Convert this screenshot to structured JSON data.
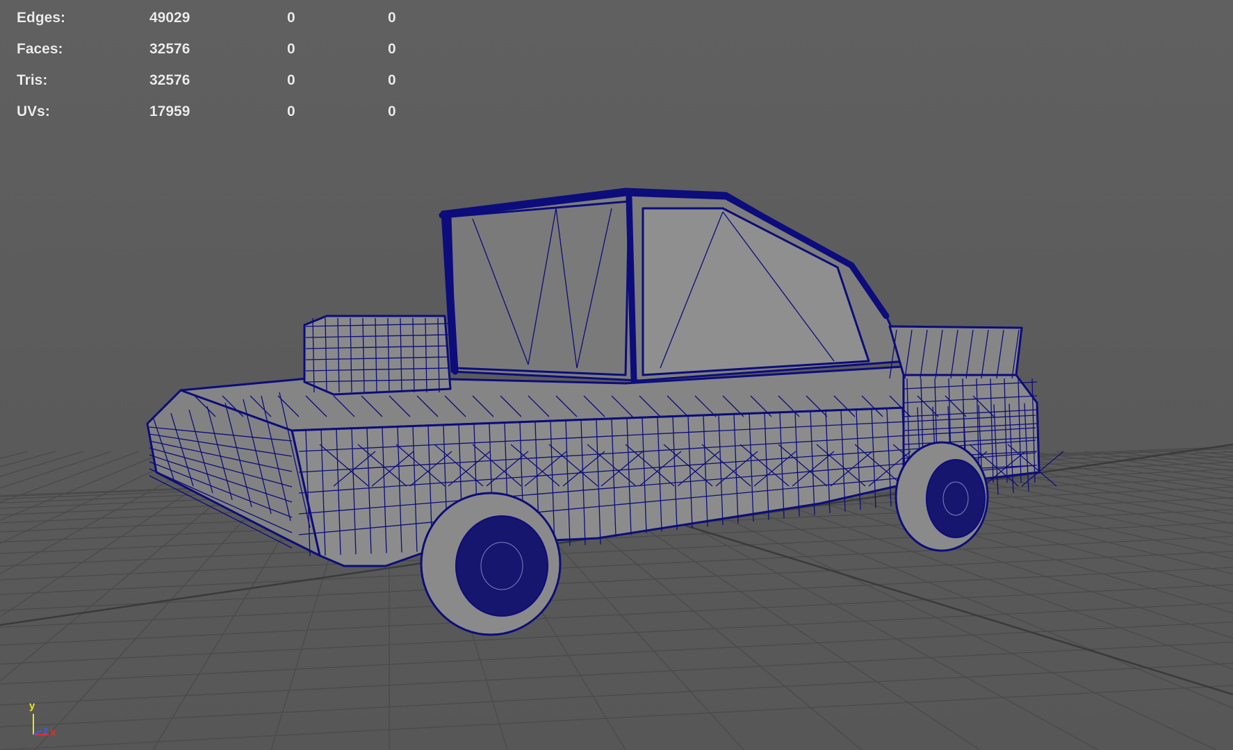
{
  "stats": {
    "rows": [
      {
        "label": "Edges:",
        "total": "49029",
        "selected": "0",
        "extra": "0"
      },
      {
        "label": "Faces:",
        "total": "32576",
        "selected": "0",
        "extra": "0"
      },
      {
        "label": "Tris:",
        "total": "32576",
        "selected": "0",
        "extra": "0"
      },
      {
        "label": "UVs:",
        "total": "17959",
        "selected": "0",
        "extra": "0"
      }
    ]
  },
  "axis_gizmo": {
    "y": "y",
    "x": "x",
    "z": "z"
  },
  "colors": {
    "background": "#5d5d5d",
    "grid": "#4a4a4a",
    "grid_axis": "#3a3a3a",
    "wireframe": "#0a0a7a",
    "mesh_fill": "#8a8a8a",
    "hud_text": "#ececec",
    "axis_x": "#e03030",
    "axis_y": "#e8e820",
    "axis_z": "#3060ff"
  },
  "icons": [
    "axis-gizmo-icon"
  ]
}
